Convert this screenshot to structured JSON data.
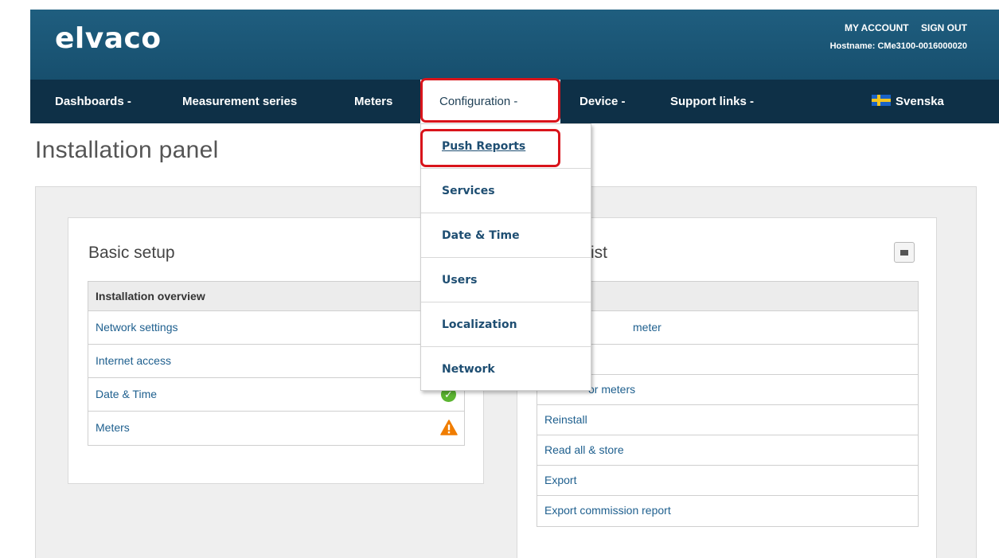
{
  "brand": {
    "logo": "elvaco"
  },
  "account": {
    "my_account": "MY ACCOUNT",
    "sign_out": "SIGN OUT",
    "hostname": "Hostname: CMe3100-0016000020"
  },
  "nav": {
    "dashboards": "Dashboards -",
    "measurement_series": "Measurement series",
    "meters": "Meters",
    "configuration": "Configuration -",
    "device": "Device -",
    "support_links": "Support links -",
    "language": "Svenska"
  },
  "dropdown": {
    "items": [
      "Push Reports",
      "Services",
      "Date & Time",
      "Users",
      "Localization",
      "Network"
    ]
  },
  "page": {
    "title": "Installation panel"
  },
  "basic_setup": {
    "title": "Basic setup",
    "header": "Installation overview",
    "rows": [
      {
        "label": "Network settings",
        "status": ""
      },
      {
        "label": "Internet access",
        "status": ""
      },
      {
        "label": "Date & Time",
        "status": "ok"
      },
      {
        "label": "Meters",
        "status": "warning"
      }
    ]
  },
  "meter_list": {
    "title_fragment": "ist",
    "rows": [
      "meter",
      "",
      "or meters",
      "Reinstall",
      "Read all & store",
      "Export",
      "Export commission report"
    ]
  },
  "colors": {
    "header_bg": "#1f5e7f",
    "nav_bg": "#0e3047",
    "link": "#1e5f8e",
    "highlight": "#d9141b",
    "ok": "#5bb531",
    "warning": "#f07d00"
  }
}
